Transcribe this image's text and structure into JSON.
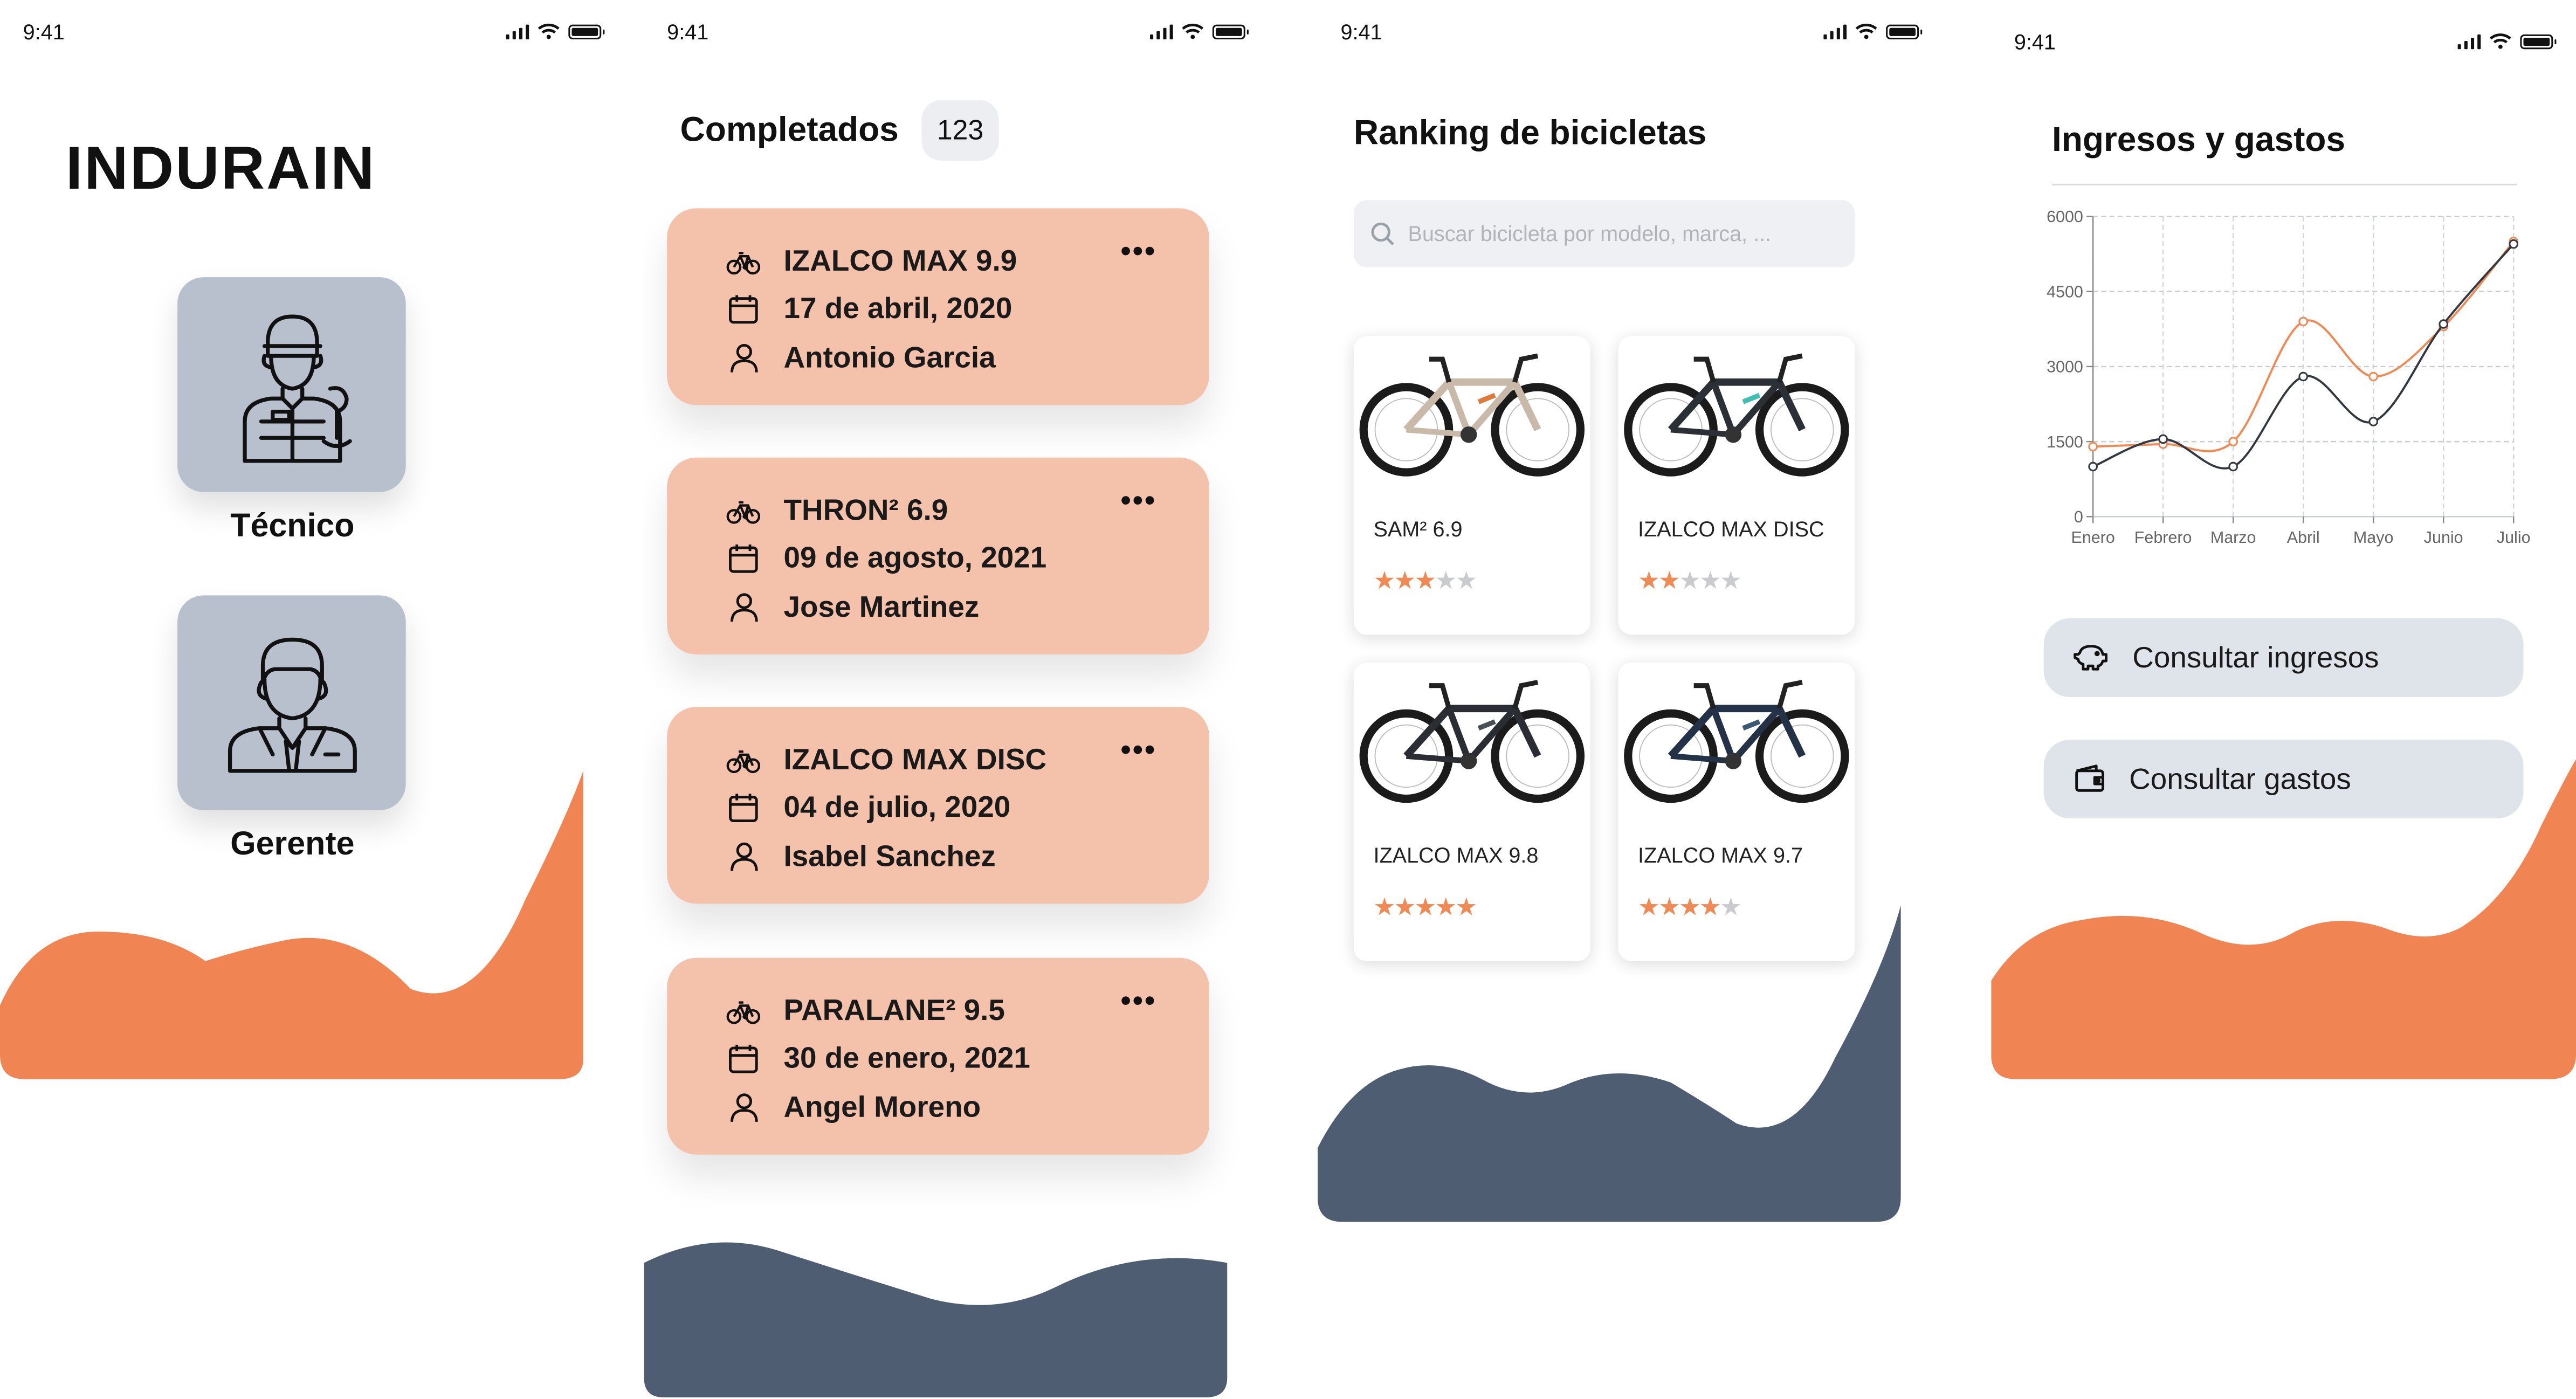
{
  "status_bar": {
    "time": "9:41"
  },
  "login": {
    "brand": "INDURAIN",
    "roles": [
      {
        "label": "Técnico",
        "icon": "mechanic-icon"
      },
      {
        "label": "Gerente",
        "icon": "manager-icon"
      }
    ]
  },
  "completed": {
    "title": "Completados",
    "count": "123",
    "items": [
      {
        "bike": "IZALCO MAX 9.9",
        "date": "17 de abril, 2020",
        "person": "Antonio Garcia"
      },
      {
        "bike": "THRON² 6.9",
        "date": "09 de agosto, 2021",
        "person": "Jose Martinez"
      },
      {
        "bike": "IZALCO MAX DISC",
        "date": "04 de julio, 2020",
        "person": "Isabel Sanchez"
      },
      {
        "bike": "PARALANE² 9.5",
        "date": "30 de enero, 2021",
        "person": "Angel Moreno"
      }
    ],
    "menu_label": "•••"
  },
  "ranking": {
    "title": "Ranking de bicicletas",
    "search_placeholder": "Buscar bicicleta por modelo, marca, ...",
    "bikes": [
      {
        "name": "SAM² 6.9",
        "rating": 3,
        "frame_color": "#c9b9a8",
        "accent": "#e07a3a"
      },
      {
        "name": "IZALCO MAX DISC",
        "rating": 2,
        "frame_color": "#2b2f36",
        "accent": "#3dbfb1"
      },
      {
        "name": "IZALCO MAX 9.8",
        "rating": 5,
        "frame_color": "#2a2d33",
        "accent": "#4a4f57"
      },
      {
        "name": "IZALCO MAX 9.7",
        "rating": 4,
        "frame_color": "#233246",
        "accent": "#3b5876"
      }
    ]
  },
  "finance": {
    "title": "Ingresos y gastos",
    "buttons": [
      {
        "label": "Consultar ingresos",
        "icon": "piggy-bank-icon"
      },
      {
        "label": "Consultar gastos",
        "icon": "wallet-icon"
      }
    ]
  },
  "chart_data": {
    "type": "line",
    "categories": [
      "Enero",
      "Febrero",
      "Marzo",
      "Abril",
      "Mayo",
      "Junio",
      "Julio"
    ],
    "yticks": [
      "0",
      "1500",
      "3000",
      "4500",
      "6000"
    ],
    "ylim": [
      0,
      6000
    ],
    "grid": true,
    "series": [
      {
        "values": [
          1400,
          1450,
          1500,
          3900,
          2800,
          3800,
          5500
        ],
        "color": "#f08a55"
      },
      {
        "values": [
          1000,
          1550,
          1000,
          2800,
          1900,
          3850,
          5450
        ],
        "color": "#333840"
      }
    ]
  },
  "colors": {
    "orange": "#f08452",
    "slate": "#4f5d73",
    "card_peach": "#f4c1aa",
    "role_card": "#b8c0cd"
  }
}
